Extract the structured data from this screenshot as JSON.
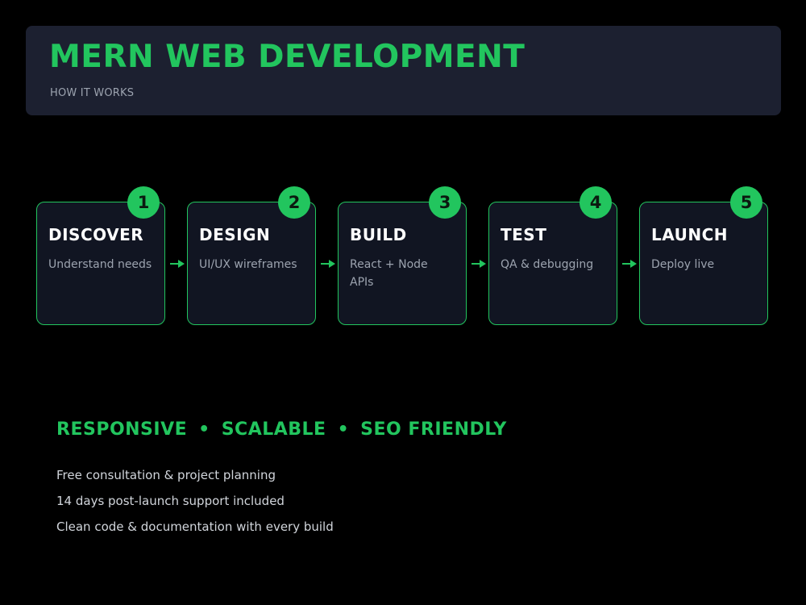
{
  "header": {
    "title": "MERN WEB DEVELOPMENT",
    "subtitle": "HOW IT WORKS"
  },
  "steps": [
    {
      "number": "1",
      "title": "DISCOVER",
      "description": "Understand needs"
    },
    {
      "number": "2",
      "title": "DESIGN",
      "description": "UI/UX wireframes"
    },
    {
      "number": "3",
      "title": "BUILD",
      "description": "React + Node APIs"
    },
    {
      "number": "4",
      "title": "TEST",
      "description": "QA & debugging"
    },
    {
      "number": "5",
      "title": "LAUNCH",
      "description": "Deploy live"
    }
  ],
  "tagline": {
    "items": [
      "RESPONSIVE",
      "SCALABLE",
      "SEO FRIENDLY"
    ],
    "separator": "•"
  },
  "features": [
    "Free consultation & project planning",
    "14 days post-launch support included",
    "Clean code & documentation with every build"
  ],
  "colors": {
    "accent": "#22c55e",
    "background": "#000000",
    "header_bg": "#1c2030",
    "card_bg": "#111522"
  }
}
